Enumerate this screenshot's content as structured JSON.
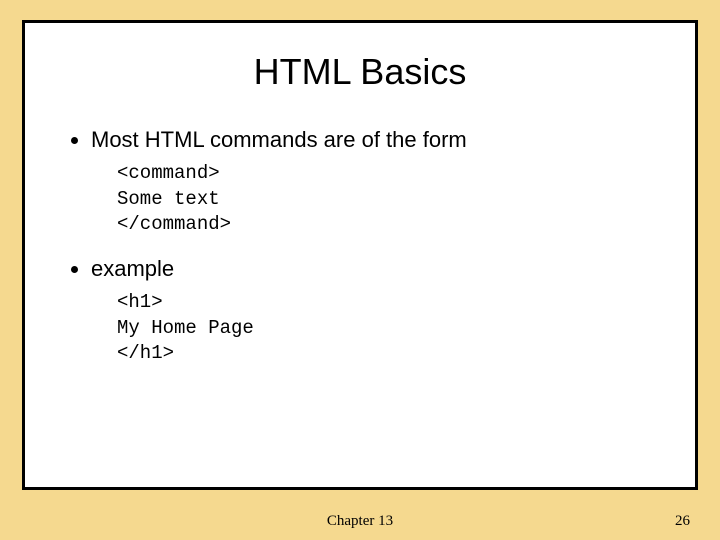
{
  "slide": {
    "title": "HTML Basics",
    "bullets": [
      {
        "text": "Most HTML commands are of the form",
        "code": "<command>\nSome text\n</command>"
      },
      {
        "text": "example",
        "code": "<h1>\nMy Home Page\n</h1>"
      }
    ]
  },
  "footer": {
    "center": "Chapter 13",
    "page_number": "26"
  }
}
